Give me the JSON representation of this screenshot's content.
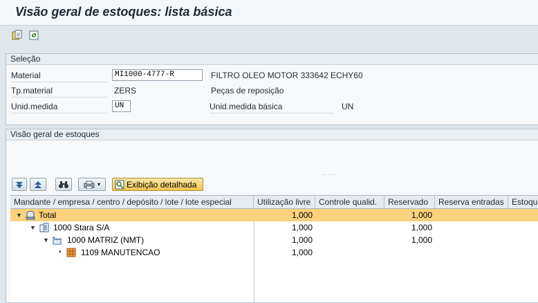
{
  "title": "Visão geral de estoques: lista básica",
  "toolbar": {
    "icons": [
      "copy-icon",
      "refresh-icon"
    ]
  },
  "selection": {
    "header": "Seleção",
    "material_label": "Material",
    "material_value": "MI1000-4777-R",
    "material_desc": "FILTRO OLEO MOTOR 333642 ECHY60",
    "tpmaterial_label": "Tp.material",
    "tpmaterial_value": "ZERS",
    "tpmaterial_desc": "Peças de reposição",
    "unid_label": "Unid.medida",
    "unid_value": "UN",
    "unid_basica_label": "Unid.medida básica",
    "unid_basica_value": "UN"
  },
  "overview": {
    "header": "Visão geral de estoques",
    "detail_button": "Exibição detalhada",
    "columns": [
      "Mandante / empresa / centro / depósito / lote / lote especial",
      "Utilização livre",
      "Controle qualid.",
      "Reservado",
      "Reserva entradas",
      "Estoqu"
    ],
    "rows": [
      {
        "label": "Total",
        "livre": "1,000",
        "reservado": "1,000"
      },
      {
        "label": "1000 Stara S/A",
        "livre": "1,000",
        "reservado": "1,000"
      },
      {
        "label": "1000 MATRIZ (NMT)",
        "livre": "1,000",
        "reservado": "1,000"
      },
      {
        "label": "1109 MANUTENCAO",
        "livre": "1,000",
        "reservado": ""
      }
    ]
  }
}
